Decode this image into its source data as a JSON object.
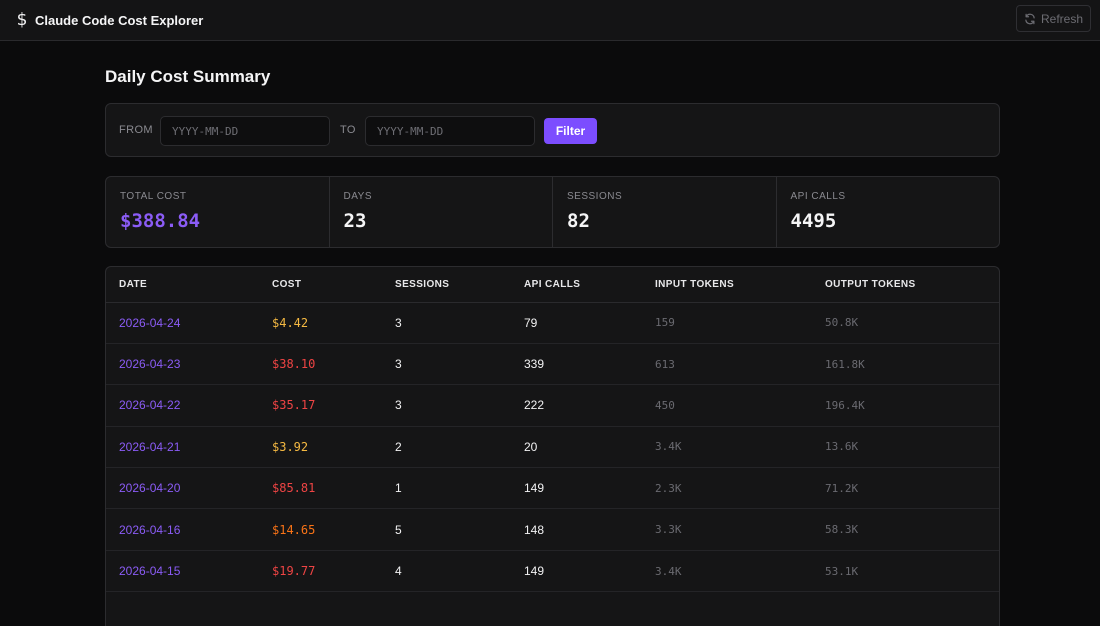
{
  "app": {
    "title": "Claude Code Cost Explorer",
    "icon": "dollar-icon",
    "refresh_label": "Refresh",
    "accent_color": "#7c4dff"
  },
  "page": {
    "title": "Daily Cost Summary"
  },
  "filter": {
    "from_label": "FROM",
    "to_label": "TO",
    "from_placeholder": "YYYY-MM-DD",
    "to_placeholder": "YYYY-MM-DD",
    "from_value": "",
    "to_value": "",
    "button_label": "Filter"
  },
  "stats": [
    {
      "label": "TOTAL COST",
      "value": "$388.84"
    },
    {
      "label": "DAYS",
      "value": "23"
    },
    {
      "label": "SESSIONS",
      "value": "82"
    },
    {
      "label": "API CALLS",
      "value": "4495"
    }
  ],
  "table": {
    "columns": [
      "DATE",
      "COST",
      "SESSIONS",
      "API CALLS",
      "INPUT TOKENS",
      "OUTPUT TOKENS"
    ],
    "rows": [
      {
        "date": "2026-04-24",
        "cost": "$4.42",
        "cost_color": "#f5b942",
        "sessions": "3",
        "api_calls": "79",
        "input_tokens": "159",
        "output_tokens": "50.8K"
      },
      {
        "date": "2026-04-23",
        "cost": "$38.10",
        "cost_color": "#ef4444",
        "sessions": "3",
        "api_calls": "339",
        "input_tokens": "613",
        "output_tokens": "161.8K"
      },
      {
        "date": "2026-04-22",
        "cost": "$35.17",
        "cost_color": "#ef4444",
        "sessions": "3",
        "api_calls": "222",
        "input_tokens": "450",
        "output_tokens": "196.4K"
      },
      {
        "date": "2026-04-21",
        "cost": "$3.92",
        "cost_color": "#f5b942",
        "sessions": "2",
        "api_calls": "20",
        "input_tokens": "3.4K",
        "output_tokens": "13.6K"
      },
      {
        "date": "2026-04-20",
        "cost": "$85.81",
        "cost_color": "#ef4444",
        "sessions": "1",
        "api_calls": "149",
        "input_tokens": "2.3K",
        "output_tokens": "71.2K"
      },
      {
        "date": "2026-04-16",
        "cost": "$14.65",
        "cost_color": "#f97316",
        "sessions": "5",
        "api_calls": "148",
        "input_tokens": "3.3K",
        "output_tokens": "58.3K"
      },
      {
        "date": "2026-04-15",
        "cost": "$19.77",
        "cost_color": "#ef4444",
        "sessions": "4",
        "api_calls": "149",
        "input_tokens": "3.4K",
        "output_tokens": "53.1K"
      }
    ]
  }
}
